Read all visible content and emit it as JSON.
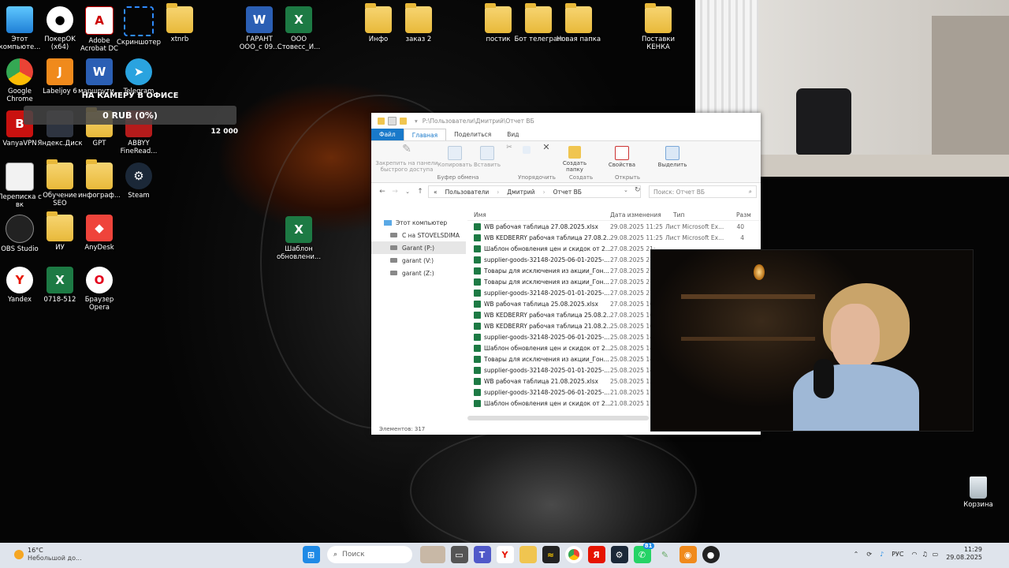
{
  "desktop_icons": [
    {
      "id": "this-pc",
      "label": "Этот компьюте..."
    },
    {
      "id": "pokerok",
      "label": "ПокерOK (x64)"
    },
    {
      "id": "acrobat",
      "label": "Adobe Acrobat DC"
    },
    {
      "id": "screenshoter",
      "label": "Скриншотер"
    },
    {
      "id": "xtnrb",
      "label": "xtnrb"
    },
    {
      "id": "garant-doc",
      "label": "ГАРАНТ ООО_с 09..."
    },
    {
      "id": "ooo-stroveс",
      "label": "ООО Стовесс_И..."
    },
    {
      "id": "info",
      "label": "Инфо"
    },
    {
      "id": "zakaz2",
      "label": "заказ 2"
    },
    {
      "id": "postik",
      "label": "постик"
    },
    {
      "id": "bot-telegram",
      "label": "Бот телеграм"
    },
    {
      "id": "new-folder",
      "label": "Новая папка"
    },
    {
      "id": "postavki-kenka",
      "label": "Поставки КЕНКА"
    },
    {
      "id": "chrome",
      "label": "Google Chrome"
    },
    {
      "id": "labeljoy",
      "label": "Labeljoy 6"
    },
    {
      "id": "marshrut",
      "label": "маршрути..."
    },
    {
      "id": "telegram",
      "label": "Telegram"
    },
    {
      "id": "vanyavpn",
      "label": "VanyaVPN"
    },
    {
      "id": "yandex-disk",
      "label": "Яндекс.Диск"
    },
    {
      "id": "gpt",
      "label": "GPT"
    },
    {
      "id": "abbyy",
      "label": "ABBYY FineRead..."
    },
    {
      "id": "perepiska",
      "label": "Переписка с вк"
    },
    {
      "id": "obuchenie",
      "label": "Обучение SEO"
    },
    {
      "id": "infograf",
      "label": "инфограф..."
    },
    {
      "id": "steam",
      "label": "Steam"
    },
    {
      "id": "shablon",
      "label": "Шаблон обновлени..."
    },
    {
      "id": "obs",
      "label": "OBS Studio"
    },
    {
      "id": "iu",
      "label": "ИУ"
    },
    {
      "id": "anydesk",
      "label": "AnyDesk"
    },
    {
      "id": "yandex",
      "label": "Yandex"
    },
    {
      "id": "f0718",
      "label": "0718-512"
    },
    {
      "id": "opera",
      "label": "Браузер Opera"
    }
  ],
  "overlay": {
    "title": "НА КАМЕРУ В ОФИСЕ",
    "amount": "0 RUB (0%)",
    "goal": "12 000",
    "progress_fraction": 0
  },
  "explorer": {
    "title_path": "P:\\Пользователи\\Дмитрий\\Отчет ВБ",
    "tabs": [
      "Файл",
      "Главная",
      "Поделиться",
      "Вид"
    ],
    "ribbon": {
      "pin": "Закрепить на панели быстрого доступа",
      "copy": "Копировать",
      "paste": "Вставить",
      "clipboard_group": "Буфер обмена",
      "organize_group": "Упорядочить",
      "new_folder": "Создать папку",
      "create_group": "Создать",
      "properties": "Свойства",
      "open_group": "Открыть",
      "select": "Выделить"
    },
    "breadcrumb": [
      "«",
      "Пользователи",
      "Дмитрий",
      "Отчет ВБ"
    ],
    "search_placeholder": "Поиск: Отчет ВБ",
    "nav_pane": [
      {
        "label": "Этот компьютер"
      },
      {
        "label": "C на STOVELSDIMA"
      },
      {
        "label": "Garant (P:)"
      },
      {
        "label": "garant (V:)"
      },
      {
        "label": "garant (Z:)"
      }
    ],
    "columns": {
      "name": "Имя",
      "date": "Дата изменения",
      "type": "Тип",
      "size": "Разм"
    },
    "files": [
      {
        "name": "WB рабочая таблица 27.08.2025.xlsx",
        "date": "29.08.2025 11:25",
        "type": "Лист Microsoft Ex...",
        "size": "40"
      },
      {
        "name": "WB KEDBERRY рабочая таблица 27.08.2...",
        "date": "29.08.2025 11:25",
        "type": "Лист Microsoft Ex...",
        "size": "4"
      },
      {
        "name": "Шаблон обновления цен и скидок от 2...",
        "date": "27.08.2025 21:",
        "type": "",
        "size": ""
      },
      {
        "name": "supplier-goods-32148-2025-06-01-2025-...",
        "date": "27.08.2025 21:",
        "type": "",
        "size": ""
      },
      {
        "name": "Товары для исключения из акции_Гон...",
        "date": "27.08.2025 21:",
        "type": "",
        "size": ""
      },
      {
        "name": "Товары для исключения из акции_Гон...",
        "date": "27.08.2025 21:",
        "type": "",
        "size": ""
      },
      {
        "name": "supplier-goods-32148-2025-01-01-2025-...",
        "date": "27.08.2025 21:",
        "type": "",
        "size": ""
      },
      {
        "name": "WB рабочая таблица 25.08.2025.xlsx",
        "date": "27.08.2025 16:",
        "type": "",
        "size": ""
      },
      {
        "name": "WB KEDBERRY рабочая таблица 25.08.2...",
        "date": "27.08.2025 16:",
        "type": "",
        "size": ""
      },
      {
        "name": "WB KEDBERRY рабочая таблица 21.08.2...",
        "date": "25.08.2025 16:",
        "type": "",
        "size": ""
      },
      {
        "name": "supplier-goods-32148-2025-06-01-2025-...",
        "date": "25.08.2025 14:",
        "type": "",
        "size": ""
      },
      {
        "name": "Шаблон обновления цен и скидок от 2...",
        "date": "25.08.2025 14:",
        "type": "",
        "size": ""
      },
      {
        "name": "Товары для исключения из акции_Гон...",
        "date": "25.08.2025 14:",
        "type": "",
        "size": ""
      },
      {
        "name": "supplier-goods-32148-2025-01-01-2025-...",
        "date": "25.08.2025 14:",
        "type": "",
        "size": ""
      },
      {
        "name": "WB рабочая таблица 21.08.2025.xlsx",
        "date": "25.08.2025 13:",
        "type": "",
        "size": ""
      },
      {
        "name": "supplier-goods-32148-2025-06-01-2025-...",
        "date": "21.08.2025 11:",
        "type": "",
        "size": ""
      },
      {
        "name": "Шаблон обновления цен и скидок от 2...",
        "date": "21.08.2025 11:",
        "type": "",
        "size": ""
      }
    ],
    "status": "Элементов: 317"
  },
  "recycle_bin": "Корзина",
  "taskbar": {
    "weather_temp": "16°C",
    "weather_desc": "Небольшой до...",
    "search_placeholder": "Поиск",
    "language": "РУС",
    "time": "11:29",
    "date": "29.08.2025",
    "whatsapp_badge": "81"
  },
  "colors": {
    "accent": "#1979ca",
    "taskbar": "#dfe4ec",
    "excel": "#1d7a44",
    "folder": "#f0c550"
  }
}
